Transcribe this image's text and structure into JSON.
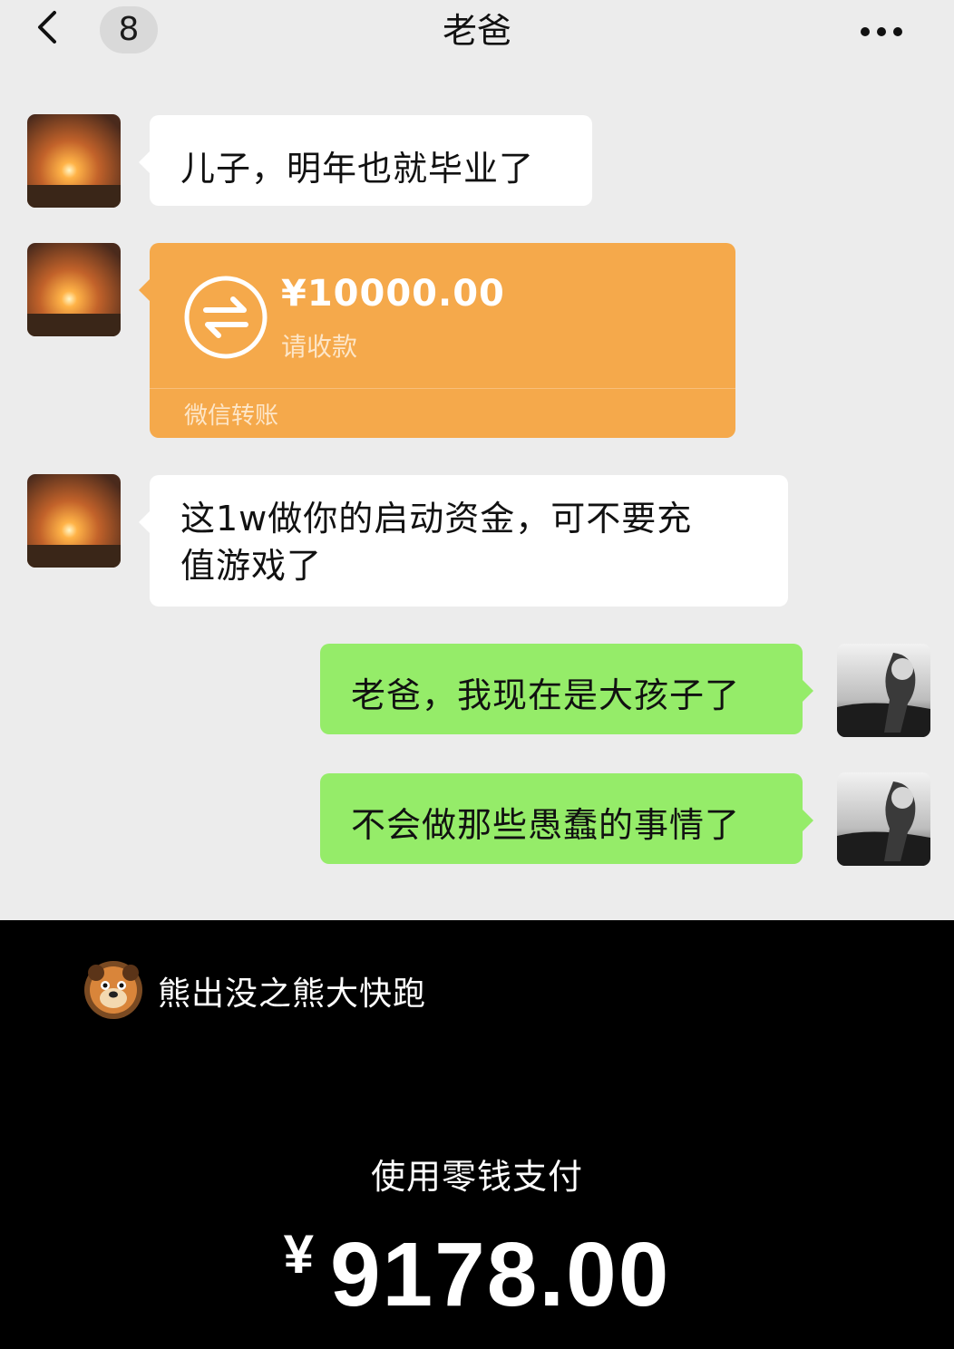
{
  "header": {
    "back_count": "8",
    "title": "老爸",
    "back_icon": "chevron-left-icon",
    "more_icon": "more-dots-icon"
  },
  "messages": [
    {
      "from": "father",
      "text": "儿子，明年也就毕业了"
    },
    {
      "from": "father",
      "type": "transfer",
      "amount": "¥10000.00",
      "status": "请收款",
      "brand": "微信转账"
    },
    {
      "from": "father",
      "text_line1": "这1w做你的启动资金，可不要充",
      "text_line2": "值游戏了"
    },
    {
      "from": "me",
      "text": "老爸，我现在是大孩子了"
    },
    {
      "from": "me",
      "text": "不会做那些愚蠢的事情了"
    }
  ],
  "payment": {
    "game_name": "熊出没之熊大快跑",
    "method": "使用零钱支付",
    "currency": "¥",
    "amount": "9178.00"
  },
  "colors": {
    "chat_background": "#ececec",
    "incoming_bubble": "#ffffff",
    "outgoing_bubble": "#95ec69",
    "transfer_card": "#f5a94b",
    "payment_sheet": "#000000"
  }
}
